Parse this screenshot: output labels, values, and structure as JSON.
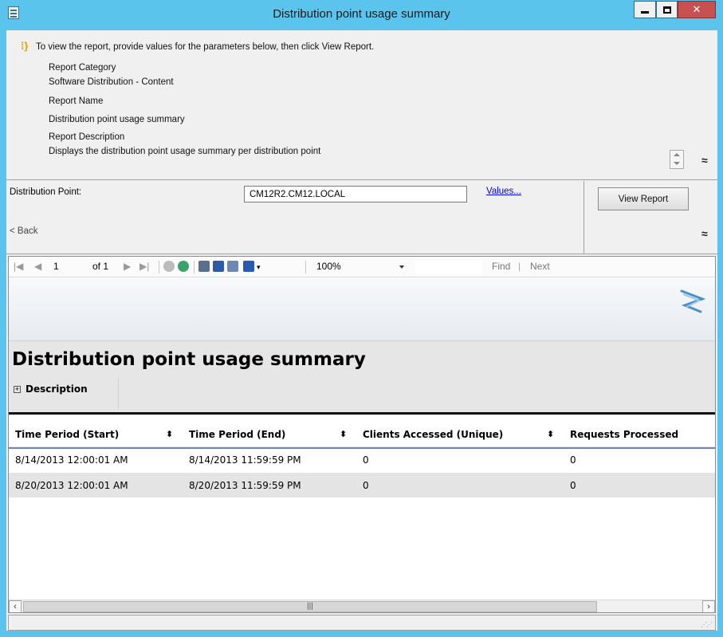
{
  "window": {
    "title": "Distribution point usage summary"
  },
  "params_info": {
    "instruction": "To view the report, provide values for the parameters below, then click View Report.",
    "category_label": "Report Category",
    "category_value": "Software Distribution - Content",
    "name_label": "Report Name",
    "name_value": "Distribution point usage summary",
    "description_label": "Report Description",
    "description_value": "Displays the distribution point usage summary per distribution point"
  },
  "params": {
    "dp_label": "Distribution Point:",
    "dp_value": "CM12R2.CM12.LOCAL",
    "values_link": "Values...",
    "view_report": "View Report",
    "back": "< Back"
  },
  "toolbar": {
    "page_current": "1",
    "page_of": "of 1",
    "zoom": "100%",
    "find": "Find",
    "find_sep": "|",
    "next": "Next"
  },
  "report": {
    "title": "Distribution point usage summary",
    "description_toggle": "Description",
    "columns": [
      "Time Period (Start)",
      "Time Period (End)",
      "Clients Accessed (Unique)",
      "Requests Processed"
    ],
    "rows": [
      [
        "8/14/2013 12:00:01 AM",
        "8/14/2013 11:59:59 PM",
        "0",
        "0"
      ],
      [
        "8/20/2013 12:00:01 AM",
        "8/20/2013 11:59:59 PM",
        "0",
        "0"
      ]
    ]
  },
  "colors": {
    "title_bar": "#5bc4ec",
    "close_button": "#c75050",
    "link": "#0000d0",
    "row_alt": "#e4e4e4"
  }
}
